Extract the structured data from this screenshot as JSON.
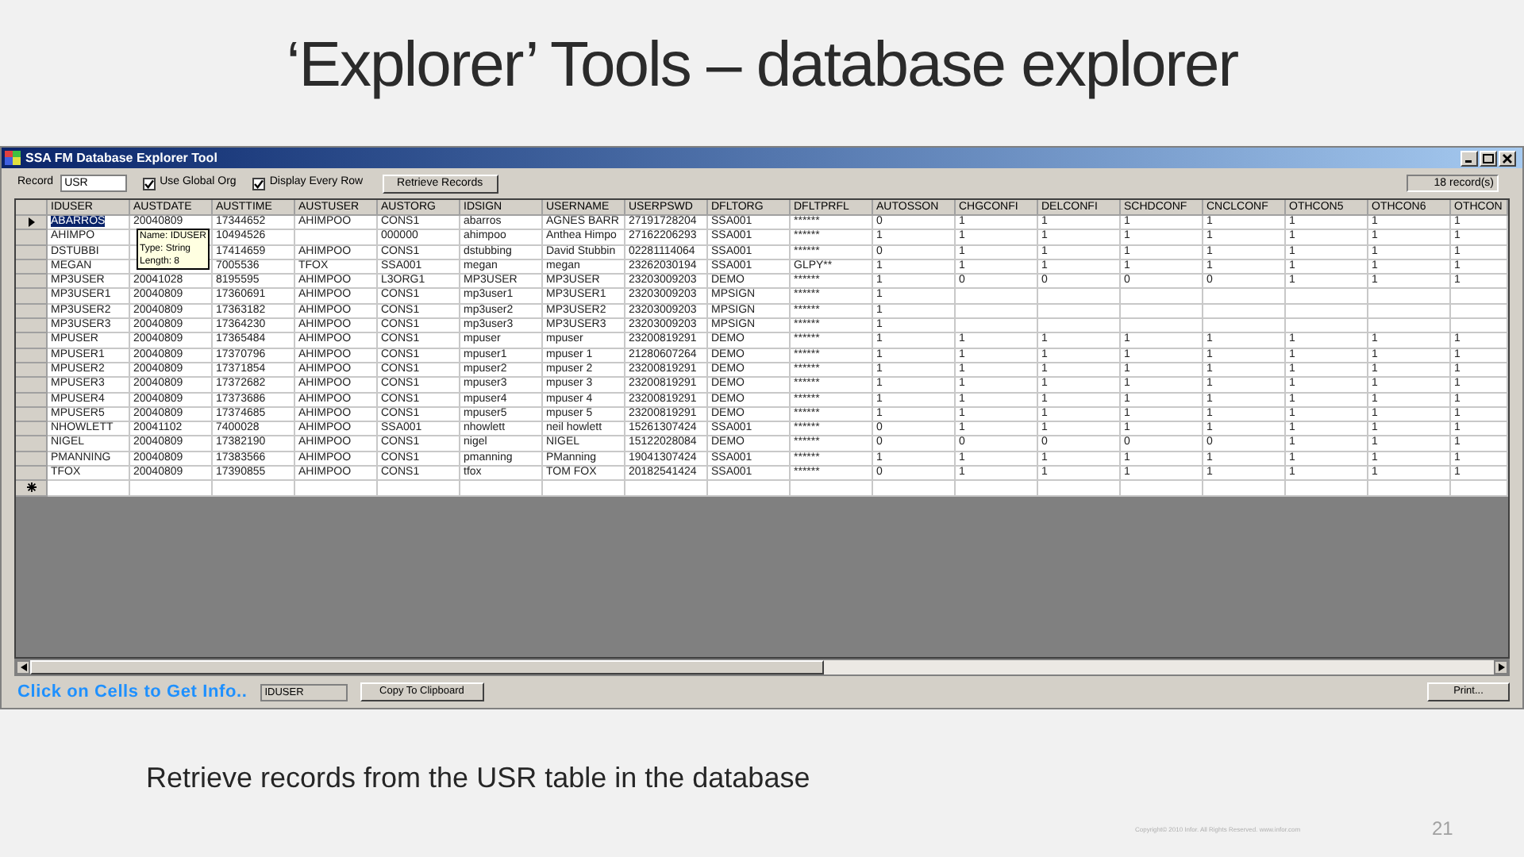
{
  "slide_title": "‘Explorer’ Tools – database explorer",
  "window": {
    "title": "SSA FM Database Explorer Tool"
  },
  "toolbar": {
    "record_label": "Record",
    "record_value": "USR",
    "checkboxes": [
      {
        "label": "Use Global Org",
        "checked": true
      },
      {
        "label": "Display Every Row",
        "checked": true
      }
    ],
    "retrieve_button": "Retrieve Records",
    "record_count": "18 record(s)"
  },
  "table": {
    "columns": [
      "IDUSER",
      "AUSTDATE",
      "AUSTTIME",
      "AUSTUSER",
      "AUSTORG",
      "IDSIGN",
      "USERNAME",
      "USERPSWD",
      "DFLTORG",
      "DFLTPRFL",
      "AUTOSSON",
      "CHGCONFI",
      "DELCONFI",
      "SCHDCONF",
      "CNCLCONF",
      "OTHCON5",
      "OTHCON6",
      "OTHCON"
    ],
    "rows": [
      {
        "selected": true,
        "cells": [
          "ABARROS",
          "20040809",
          "17344652",
          "AHIMPOO",
          "CONS1",
          "abarros",
          "AGNES BARR",
          "27191728204",
          "SSA001",
          "******",
          "0",
          "1",
          "1",
          "1",
          "1",
          "1",
          "1",
          "1"
        ]
      },
      {
        "selected": false,
        "cells": [
          "AHIMPO",
          null,
          "10494526",
          null,
          "000000",
          "ahimpoo",
          "Anthea Himpo",
          "27162206293",
          "SSA001",
          "******",
          "1",
          "1",
          "1",
          "1",
          "1",
          "1",
          "1",
          "1"
        ]
      },
      {
        "selected": false,
        "cells": [
          "DSTUBBI",
          null,
          "17414659",
          "AHIMPOO",
          "CONS1",
          "dstubbing",
          "David Stubbin",
          "02281114064",
          "SSA001",
          "******",
          "0",
          "1",
          "1",
          "1",
          "1",
          "1",
          "1",
          "1"
        ]
      },
      {
        "selected": false,
        "cells": [
          "MEGAN",
          null,
          "7005536",
          "TFOX",
          "SSA001",
          "megan",
          "megan",
          "23262030194",
          "SSA001",
          "GLPY**",
          "1",
          "1",
          "1",
          "1",
          "1",
          "1",
          "1",
          "1"
        ]
      },
      {
        "selected": false,
        "cells": [
          "MP3USER",
          "20041028",
          "8195595",
          "AHIMPOO",
          "L3ORG1",
          "MP3USER",
          "MP3USER",
          "23203009203",
          "DEMO",
          "******",
          "1",
          "0",
          "0",
          "0",
          "0",
          "1",
          "1",
          "1"
        ]
      },
      {
        "selected": false,
        "cells": [
          "MP3USER1",
          "20040809",
          "17360691",
          "AHIMPOO",
          "CONS1",
          "mp3user1",
          "MP3USER1",
          "23203009203",
          "MPSIGN",
          "******",
          "1",
          null,
          null,
          null,
          null,
          null,
          null,
          null
        ]
      },
      {
        "selected": false,
        "cells": [
          "MP3USER2",
          "20040809",
          "17363182",
          "AHIMPOO",
          "CONS1",
          "mp3user2",
          "MP3USER2",
          "23203009203",
          "MPSIGN",
          "******",
          "1",
          null,
          null,
          null,
          null,
          null,
          null,
          null
        ]
      },
      {
        "selected": false,
        "cells": [
          "MP3USER3",
          "20040809",
          "17364230",
          "AHIMPOO",
          "CONS1",
          "mp3user3",
          "MP3USER3",
          "23203009203",
          "MPSIGN",
          "******",
          "1",
          null,
          null,
          null,
          null,
          null,
          null,
          null
        ]
      },
      {
        "selected": false,
        "cells": [
          "MPUSER",
          "20040809",
          "17365484",
          "AHIMPOO",
          "CONS1",
          "mpuser",
          "mpuser",
          "23200819291",
          "DEMO",
          "******",
          "1",
          "1",
          "1",
          "1",
          "1",
          "1",
          "1",
          "1"
        ]
      },
      {
        "selected": false,
        "cells": [
          "MPUSER1",
          "20040809",
          "17370796",
          "AHIMPOO",
          "CONS1",
          "mpuser1",
          "mpuser 1",
          "21280607264",
          "DEMO",
          "******",
          "1",
          "1",
          "1",
          "1",
          "1",
          "1",
          "1",
          "1"
        ]
      },
      {
        "selected": false,
        "cells": [
          "MPUSER2",
          "20040809",
          "17371854",
          "AHIMPOO",
          "CONS1",
          "mpuser2",
          "mpuser 2",
          "23200819291",
          "DEMO",
          "******",
          "1",
          "1",
          "1",
          "1",
          "1",
          "1",
          "1",
          "1"
        ]
      },
      {
        "selected": false,
        "cells": [
          "MPUSER3",
          "20040809",
          "17372682",
          "AHIMPOO",
          "CONS1",
          "mpuser3",
          "mpuser 3",
          "23200819291",
          "DEMO",
          "******",
          "1",
          "1",
          "1",
          "1",
          "1",
          "1",
          "1",
          "1"
        ]
      },
      {
        "selected": false,
        "cells": [
          "MPUSER4",
          "20040809",
          "17373686",
          "AHIMPOO",
          "CONS1",
          "mpuser4",
          "mpuser 4",
          "23200819291",
          "DEMO",
          "******",
          "1",
          "1",
          "1",
          "1",
          "1",
          "1",
          "1",
          "1"
        ]
      },
      {
        "selected": false,
        "cells": [
          "MPUSER5",
          "20040809",
          "17374685",
          "AHIMPOO",
          "CONS1",
          "mpuser5",
          "mpuser 5",
          "23200819291",
          "DEMO",
          "******",
          "1",
          "1",
          "1",
          "1",
          "1",
          "1",
          "1",
          "1"
        ]
      },
      {
        "selected": false,
        "cells": [
          "NHOWLETT",
          "20041102",
          "7400028",
          "AHIMPOO",
          "SSA001",
          "nhowlett",
          "neil howlett",
          "15261307424",
          "SSA001",
          "******",
          "0",
          "1",
          "1",
          "1",
          "1",
          "1",
          "1",
          "1"
        ]
      },
      {
        "selected": false,
        "cells": [
          "NIGEL",
          "20040809",
          "17382190",
          "AHIMPOO",
          "CONS1",
          "nigel",
          "NIGEL",
          "15122028084",
          "DEMO",
          "******",
          "0",
          "0",
          "0",
          "0",
          "0",
          "1",
          "1",
          "1"
        ]
      },
      {
        "selected": false,
        "cells": [
          "PMANNING",
          "20040809",
          "17383566",
          "AHIMPOO",
          "CONS1",
          "pmanning",
          "PManning",
          "19041307424",
          "SSA001",
          "******",
          "1",
          "1",
          "1",
          "1",
          "1",
          "1",
          "1",
          "1"
        ]
      },
      {
        "selected": false,
        "cells": [
          "TFOX",
          "20040809",
          "17390855",
          "AHIMPOO",
          "CONS1",
          "tfox",
          "TOM FOX",
          "20182541424",
          "SSA001",
          "******",
          "0",
          "1",
          "1",
          "1",
          "1",
          "1",
          "1",
          "1"
        ]
      }
    ]
  },
  "tooltip": {
    "lines": [
      "Name: IDUSER",
      "Type: String",
      "Length: 8"
    ]
  },
  "status_bar": {
    "hint": "Click on Cells to Get Info..",
    "field_value": "IDUSER",
    "copy_button": "Copy To Clipboard",
    "print_button": "Print..."
  },
  "caption": "Retrieve records from the USR table in the database",
  "footer": {
    "copyright": "Copyright© 2010 Infor. All Rights Reserved. www.infor.com",
    "page": "21"
  }
}
